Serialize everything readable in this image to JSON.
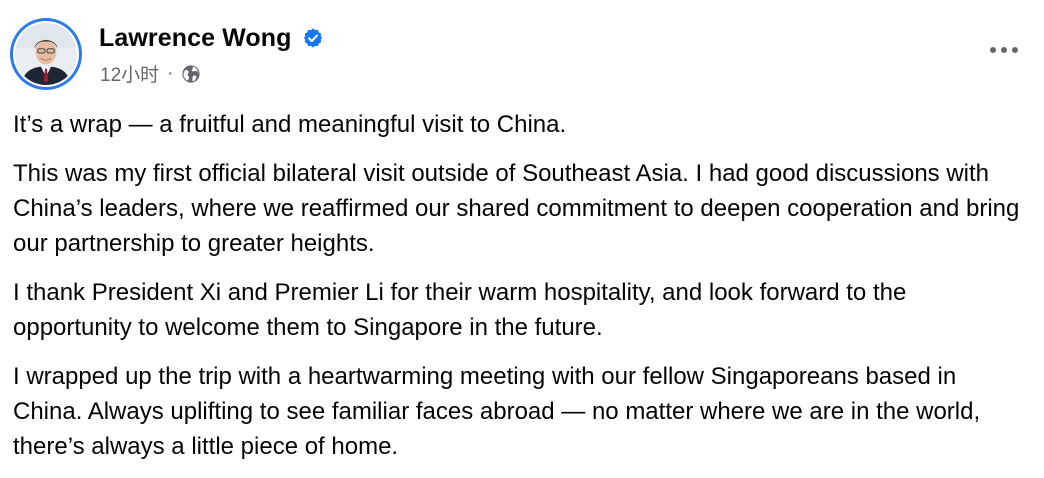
{
  "post": {
    "author": "Lawrence Wong",
    "timestamp": "12小时",
    "separator": "·",
    "verified_icon": "verified-badge-icon",
    "audience_icon": "globe-icon",
    "menu_icon": "more-options-icon",
    "paragraphs": [
      "It’s a wrap — a fruitful and meaningful visit to China.",
      "This was my first official bilateral visit outside of Southeast Asia. I had good discussions with China’s leaders, where we reaffirmed our shared commitment to deepen cooperation and bring our partnership to greater heights.",
      "I thank President Xi and Premier Li for their warm hospitality, and look forward to the opportunity to welcome them to Singapore in the future.",
      "I wrapped up the trip with a heartwarming meeting with our fellow Singaporeans based in China. Always uplifting to see familiar faces abroad — no matter where we are in the world, there’s always a little piece of home."
    ]
  },
  "colors": {
    "verified_blue": "#1877f2",
    "avatar_ring": "#2d7bea",
    "secondary_text": "#65676b",
    "primary_text": "#050505"
  }
}
